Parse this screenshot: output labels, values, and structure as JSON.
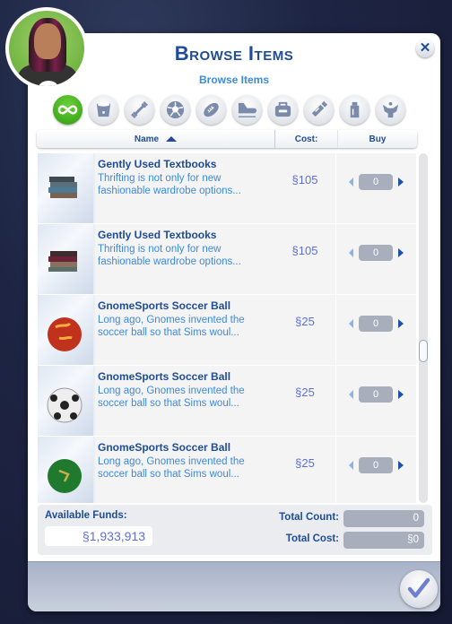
{
  "dialog": {
    "title": "Browse Items",
    "subtitle": "Browse Items",
    "close_icon": "close-icon",
    "confirm_icon": "checkmark-icon"
  },
  "categories": [
    {
      "name": "all-icon",
      "active": true
    },
    {
      "name": "bucket-icon",
      "active": false
    },
    {
      "name": "dumbbell-icon",
      "active": false
    },
    {
      "name": "soccer-ball-icon",
      "active": false
    },
    {
      "name": "football-icon",
      "active": false
    },
    {
      "name": "skate-icon",
      "active": false
    },
    {
      "name": "bag-icon",
      "active": false
    },
    {
      "name": "usb-stick-icon",
      "active": false
    },
    {
      "name": "bottle-icon",
      "active": false
    },
    {
      "name": "trophy-icon",
      "active": false
    }
  ],
  "columns": {
    "name": "Name",
    "cost": "Cost:",
    "buy": "Buy"
  },
  "items": [
    {
      "name": "Gently Used Textbooks",
      "desc": "Thrifting is not only for new fashionable wardrobe options...",
      "cost": "105",
      "qty": "0",
      "thumb": "books-blue"
    },
    {
      "name": "Gently Used Textbooks",
      "desc": "Thrifting is not only for new fashionable wardrobe options...",
      "cost": "105",
      "qty": "0",
      "thumb": "books-red"
    },
    {
      "name": "GnomeSports Soccer Ball",
      "desc": "Long ago, Gnomes invented the soccer ball so that Sims woul...",
      "cost": "25",
      "qty": "0",
      "thumb": "ball-red"
    },
    {
      "name": "GnomeSports Soccer Ball",
      "desc": "Long ago, Gnomes invented the soccer ball so that Sims woul...",
      "cost": "25",
      "qty": "0",
      "thumb": "ball-classic"
    },
    {
      "name": "GnomeSports Soccer Ball",
      "desc": "Long ago, Gnomes invented the soccer ball so that Sims woul...",
      "cost": "25",
      "qty": "0",
      "thumb": "ball-green"
    }
  ],
  "currency_symbol": "§",
  "totals": {
    "available_funds_label": "Available Funds:",
    "available_funds": "§1,933,913",
    "total_count_label": "Total Count:",
    "total_count": "0",
    "total_cost_label": "Total Cost:",
    "total_cost": "§0"
  },
  "colors": {
    "accent": "#1e4c96",
    "link": "#3b8ade",
    "active": "#3fb11c"
  }
}
